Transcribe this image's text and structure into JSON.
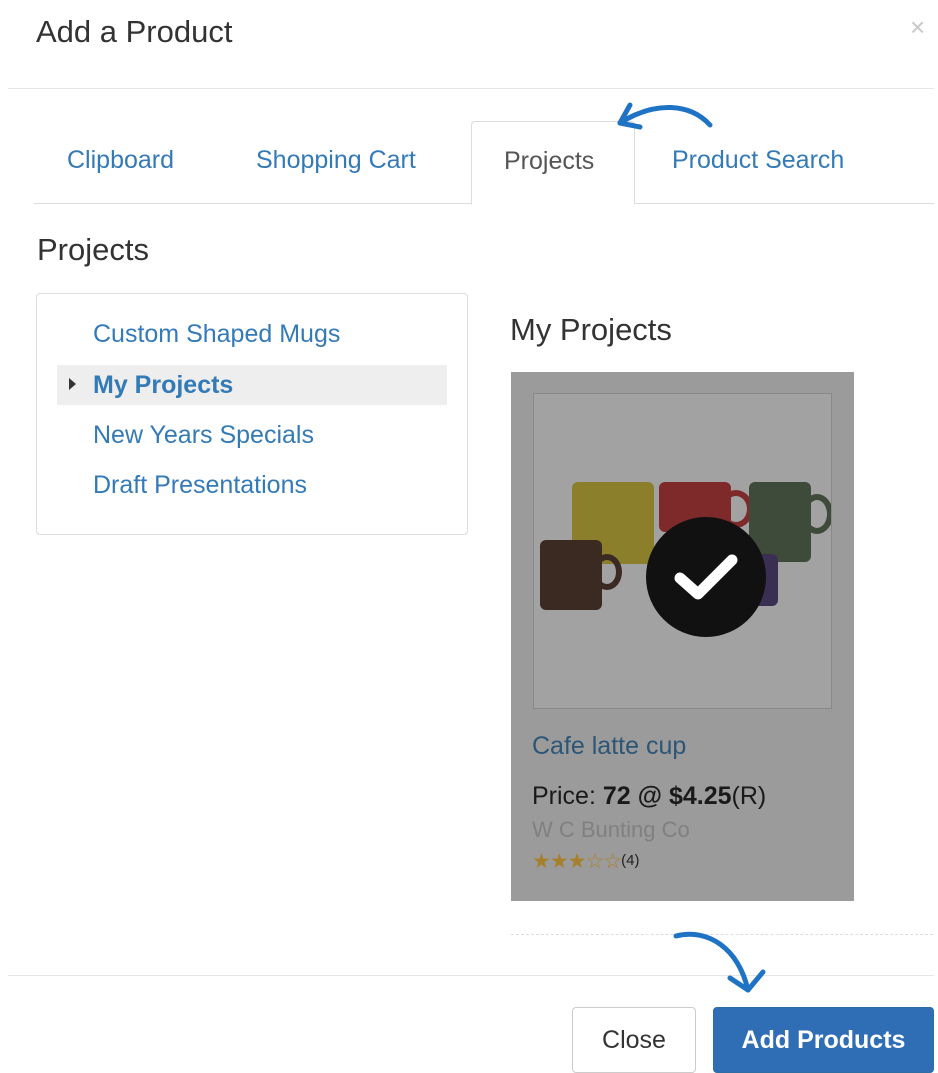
{
  "modal": {
    "title": "Add a Product",
    "close_glyph": "×"
  },
  "tabs": [
    {
      "label": "Clipboard",
      "active": false
    },
    {
      "label": "Shopping Cart",
      "active": false
    },
    {
      "label": "Projects",
      "active": true
    },
    {
      "label": "Product Search",
      "active": false
    }
  ],
  "section": {
    "title": "Projects"
  },
  "project_list": [
    {
      "label": "Custom Shaped Mugs",
      "active": false
    },
    {
      "label": "My Projects",
      "active": true
    },
    {
      "label": "New Years Specials",
      "active": false
    },
    {
      "label": "Draft Presentations",
      "active": false
    }
  ],
  "detail": {
    "title": "My Projects",
    "product": {
      "name": "Cafe latte cup",
      "price_prefix": "Price: ",
      "quantity": "72",
      "at": " @ ",
      "price": "$4.25",
      "price_suffix": "(R)",
      "supplier": "W C Bunting Co",
      "rating": 3,
      "rating_max": 5,
      "stars_full": "★★★",
      "stars_empty": "☆☆",
      "rating_count": "(4)",
      "selected": true
    }
  },
  "footer": {
    "close_label": "Close",
    "add_label": "Add Products"
  },
  "colors": {
    "link": "#337ab7",
    "primary": "#2f6eb5",
    "annotation_arrow": "#1f73c4",
    "star": "#a7802e"
  },
  "icons": {
    "check": "check-icon",
    "caret": "caret-right-icon",
    "arrow": "curved-arrow-icon"
  }
}
